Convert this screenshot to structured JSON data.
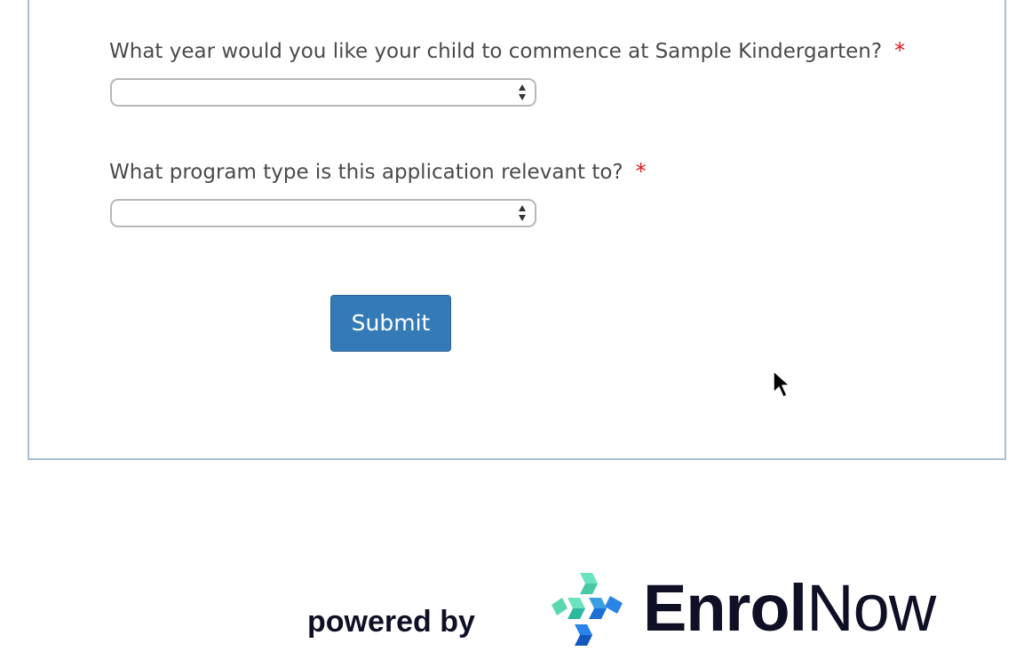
{
  "form": {
    "questions": [
      {
        "label": "What year would you like your child to commence at Sample Kindergarten?",
        "required_marker": "*",
        "selected_value": ""
      },
      {
        "label": "What program type is this application relevant to?",
        "required_marker": "*",
        "selected_value": ""
      }
    ],
    "submit_label": "Submit"
  },
  "footer": {
    "powered_by": "powered by",
    "brand_bold": "Enrol",
    "brand_light": "Now"
  },
  "colors": {
    "accent": "#347ab7",
    "required": "#e0141e",
    "panel_border": "#a9bfd3",
    "brand_dark": "#0f1025",
    "logo_teal": "#5ad7b0",
    "logo_blue": "#1d6fd6"
  }
}
